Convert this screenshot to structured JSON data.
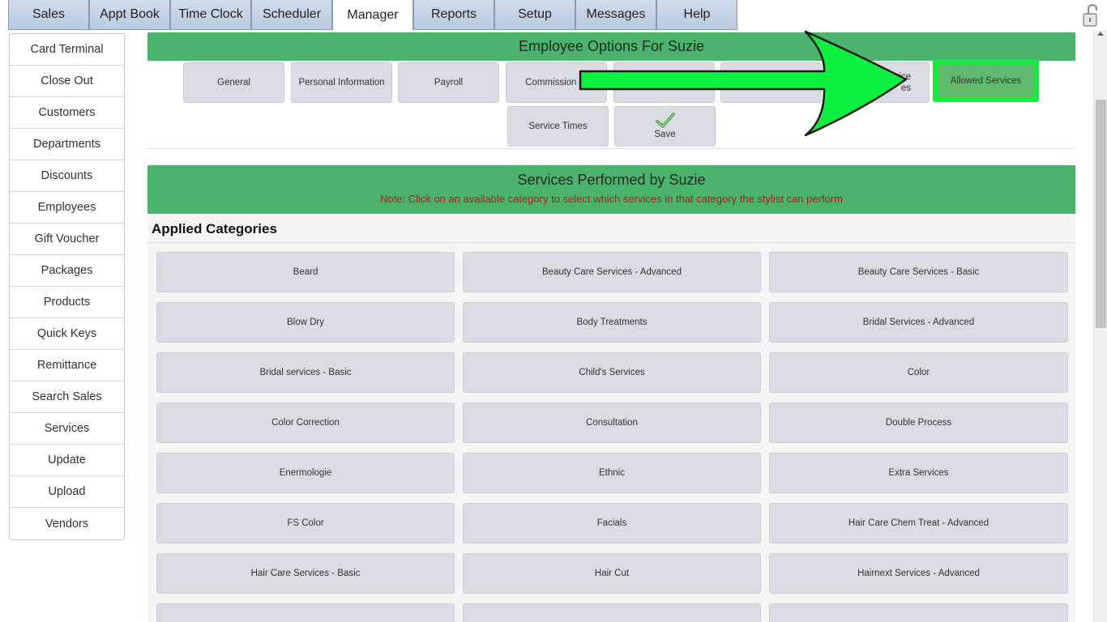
{
  "nav": {
    "tabs": [
      "Sales",
      "Appt Book",
      "Time Clock",
      "Scheduler",
      "Manager",
      "Reports",
      "Setup",
      "Messages",
      "Help"
    ],
    "active_tab": "Manager"
  },
  "sidebar": {
    "items": [
      "Card Terminal",
      "Close Out",
      "Customers",
      "Departments",
      "Discounts",
      "Employees",
      "Gift Voucher",
      "Packages",
      "Products",
      "Quick Keys",
      "Remittance",
      "Search Sales",
      "Services",
      "Update",
      "Upload",
      "Vendors"
    ]
  },
  "options": {
    "title": "Employee Options For Suzie",
    "buttons": {
      "general": "General",
      "personal": "Personal Information",
      "payroll": "Payroll",
      "commission": "Commission Pl",
      "service_line1": "vice",
      "service_line2": "es",
      "allowed": "Allowed Services",
      "service_times": "Service Times",
      "save": "Save"
    }
  },
  "services": {
    "title": "Services Performed by Suzie",
    "note": "Note: Click on an available category to select which services in that category the stylist can perform",
    "applied_heading": "Applied Categories",
    "categories": [
      "Beard",
      "Beauty Care Services - Advanced",
      "Beauty Care Services - Basic",
      "Blow Dry",
      "Body Treatments",
      "Bridal Services - Advanced",
      "Bridal services - Basic",
      "Child's Services",
      "Color",
      "Color Correction",
      "Consultation",
      "Double Process",
      "Enermologie",
      "Ethnic",
      "Extra Services",
      "FS Color",
      "Facials",
      "Hair Care Chem Treat - Advanced",
      "Hair Care Services - Basic",
      "Hair Cut",
      "Hairnext Services - Advanced",
      "",
      "",
      ""
    ]
  },
  "colors": {
    "header_green": "#4bb36b",
    "highlight_green": "#10ee3b",
    "note_red": "#b31a1a"
  },
  "icons": {
    "lock": "lock-icon",
    "save": "checkmark-icon",
    "annotation": "arrow-right-icon"
  }
}
